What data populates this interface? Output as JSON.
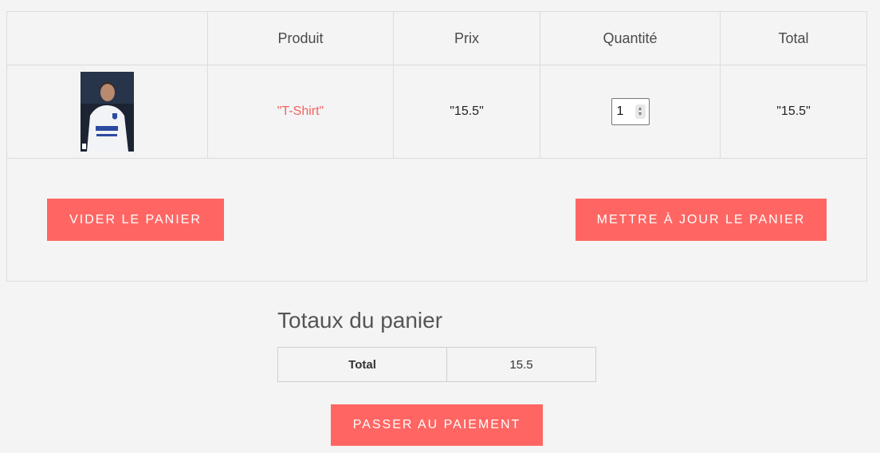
{
  "cart": {
    "headers": {
      "image": "",
      "product": "Produit",
      "price": "Prix",
      "quantity": "Quantité",
      "total": "Total"
    },
    "items": [
      {
        "image_icon": "tshirt-player-photo",
        "product_name": "\"T-Shirt\"",
        "price": "\"15.5\"",
        "quantity": "1",
        "total": "\"15.5\""
      }
    ],
    "empty_button": "VIDER LE PANIER",
    "update_button": "METTRE À JOUR LE PANIER"
  },
  "totals": {
    "title": "Totaux du panier",
    "total_label": "Total",
    "total_value": "15.5",
    "checkout_button": "PASSER AU PAIEMENT"
  },
  "colors": {
    "accent": "#ff6663",
    "link": "#f3625e",
    "background": "#f4f4f4"
  }
}
